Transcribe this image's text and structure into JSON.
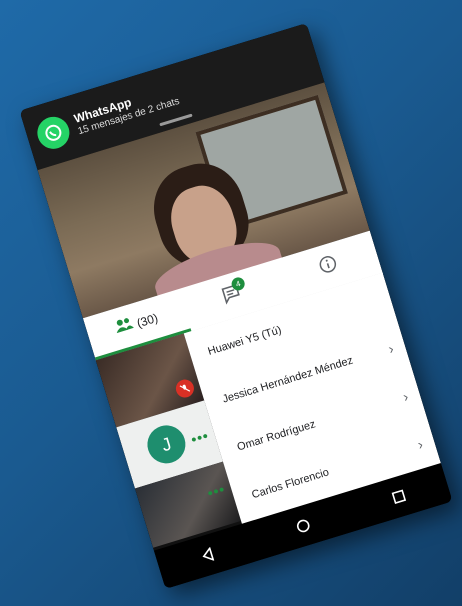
{
  "notification": {
    "app": "WhatsApp",
    "message": "15 mensajes de 2 chats",
    "icon": "whatsapp-icon",
    "color": "#25d366"
  },
  "tabs": {
    "people_count": "(30)",
    "chat_badge": "4",
    "people_icon": "people-icon",
    "chat_icon": "chat-icon",
    "info_icon": "info-icon"
  },
  "participants": [
    {
      "name": "Huawei Y5 (Tú)"
    },
    {
      "name": "Jessica Hernández Méndez"
    },
    {
      "name": "Omar Rodríguez"
    },
    {
      "name": "Carlos Florencio"
    }
  ],
  "tiles": {
    "avatar_letter": "J"
  },
  "colors": {
    "accent": "#1e8e3e",
    "mic_off": "#d93025",
    "pin": "#8b1a2e"
  }
}
